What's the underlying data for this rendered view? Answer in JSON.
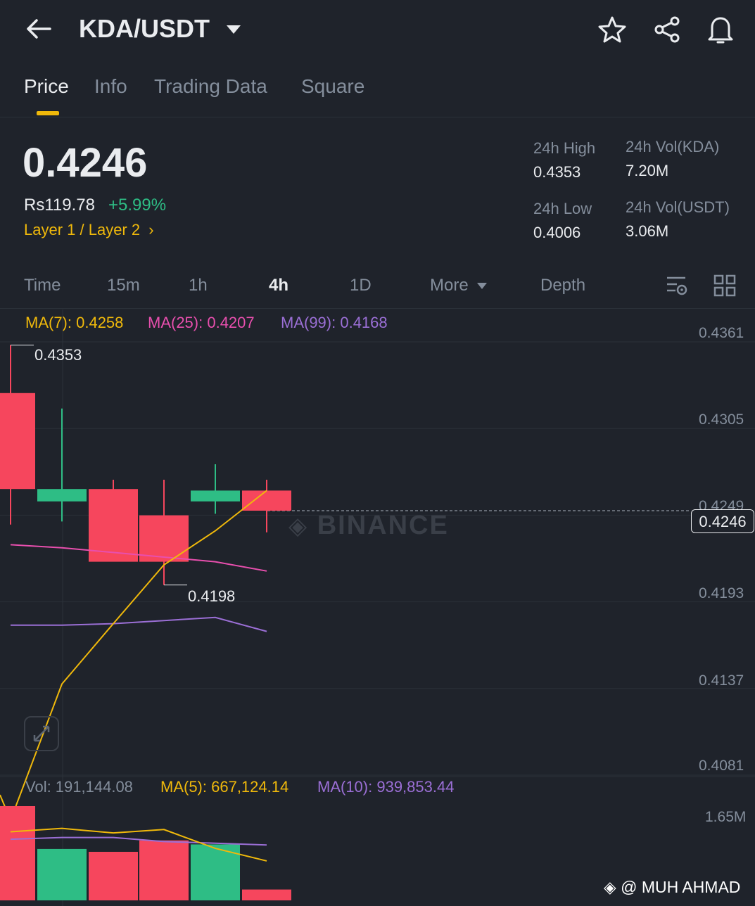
{
  "header": {
    "pair": "KDA/USDT"
  },
  "tabs": [
    {
      "label": "Price",
      "active": true
    },
    {
      "label": "Info"
    },
    {
      "label": "Trading Data"
    },
    {
      "label": "Square"
    }
  ],
  "ticker": {
    "last_price": "0.4246",
    "fiat_price": "Rs119.78",
    "change_pct": "+5.99%",
    "sector": "Layer 1 / Layer 2",
    "high_label": "24h High",
    "high": "0.4353",
    "low_label": "24h Low",
    "low": "0.4006",
    "vol_base_label": "24h Vol(KDA)",
    "vol_base": "7.20M",
    "vol_quote_label": "24h Vol(USDT)",
    "vol_quote": "3.06M"
  },
  "intervals": [
    "Time",
    "15m",
    "1h",
    "4h",
    "1D",
    "More",
    "Depth"
  ],
  "active_interval": "4h",
  "indicators": {
    "ma7": "MA(7): 0.4258",
    "ma25": "MA(25): 0.4207",
    "ma99": "MA(99): 0.4168",
    "vol": "Vol: 191,144.08",
    "vol_ma5": "MA(5): 667,124.14",
    "vol_ma10": "MA(10): 939,853.44"
  },
  "price_axis": [
    "0.4361",
    "0.4305",
    "0.4249",
    "0.4193",
    "0.4137",
    "0.4081"
  ],
  "current_price_tag": "0.4246",
  "high_marker": "0.4353",
  "low_marker": "0.4198",
  "vol_axis": "1.65M",
  "watermark": "BINANCE",
  "credit": "@ MUH AHMAD",
  "colors": {
    "up": "#2ebd85",
    "down": "#f6465d",
    "accent": "#f0b90b",
    "ma25": "#e84fae",
    "ma99": "#9b6fd6"
  },
  "chart_data": {
    "type": "candlestick",
    "candles": [
      {
        "open": 0.4322,
        "high": 0.4353,
        "low": 0.4237,
        "close": 0.426
      },
      {
        "open": 0.4252,
        "high": 0.4312,
        "low": 0.4239,
        "close": 0.426
      },
      {
        "open": 0.426,
        "high": 0.4266,
        "low": 0.4214,
        "close": 0.4213
      },
      {
        "open": 0.4243,
        "high": 0.4266,
        "low": 0.4198,
        "close": 0.4213
      },
      {
        "open": 0.4252,
        "high": 0.4276,
        "low": 0.4244,
        "close": 0.4259
      },
      {
        "open": 0.4259,
        "high": 0.4266,
        "low": 0.4232,
        "close": 0.4246
      }
    ],
    "ma7": [
      0.4046,
      0.4134,
      0.4173,
      0.4211,
      0.4233,
      0.4259
    ],
    "ma25": [
      0.4224,
      0.4222,
      0.4219,
      0.4216,
      0.4213,
      0.4207
    ],
    "ma99": [
      0.4172,
      0.4172,
      0.4173,
      0.4175,
      0.4177,
      0.4168
    ],
    "ylim": [
      0.4081,
      0.4361
    ],
    "volumes": [
      1.65,
      0.9,
      0.85,
      1.05,
      0.98,
      0.19
    ],
    "vol_ma5": [
      1.2,
      1.26,
      1.18,
      1.24,
      0.91,
      0.69
    ],
    "vol_ma10": [
      1.07,
      1.1,
      1.1,
      1.03,
      1.0,
      0.97
    ],
    "vol_unit": "M"
  }
}
